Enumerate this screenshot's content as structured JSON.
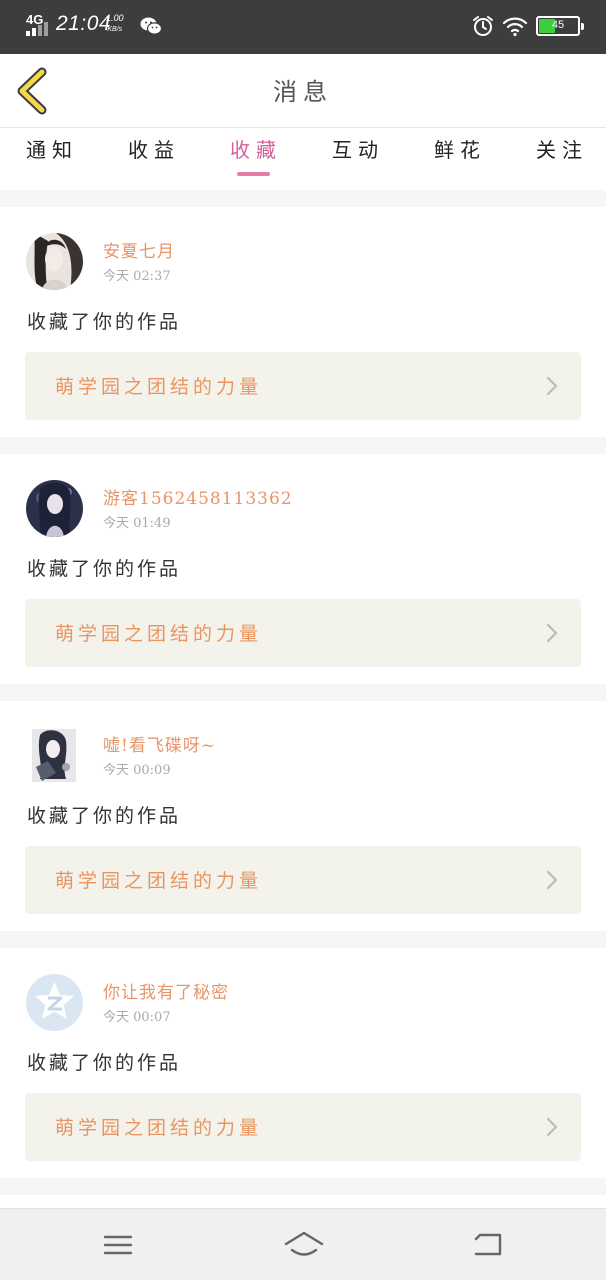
{
  "status_bar": {
    "network": "4G",
    "time": "21:04",
    "speed_value": "1.00",
    "speed_unit": "KB/s",
    "battery_text": "45",
    "battery_level": 0.45,
    "icons": [
      "signal-icon",
      "wechat-icon",
      "alarm-icon",
      "wifi-icon",
      "battery-icon"
    ]
  },
  "header": {
    "title": "消息",
    "back_icon": "chevron-left-icon"
  },
  "tabs": [
    {
      "label": "通知"
    },
    {
      "label": "收益"
    },
    {
      "label": "收藏",
      "active": true
    },
    {
      "label": "互动"
    },
    {
      "label": "鲜花"
    },
    {
      "label": "关注"
    }
  ],
  "colors": {
    "accent_pink": "#d6609a",
    "name_orange": "#e8956a",
    "work_orange": "#ea9560",
    "status_bar": "#3d3d3d",
    "battery_green": "#3ccf3c"
  },
  "notifications": [
    {
      "user": "安夏七月",
      "time": "今天 02:37",
      "action": "收藏了你的作品",
      "work": "萌学园之团结的力量"
    },
    {
      "user": "游客1562458113362",
      "time": "今天 01:49",
      "action": "收藏了你的作品",
      "work": "萌学园之团结的力量"
    },
    {
      "user": "嘘!看飞碟呀~",
      "time": "今天 00:09",
      "action": "收藏了你的作品",
      "work": "萌学园之团结的力量"
    },
    {
      "user": "你让我有了秘密",
      "time": "今天 00:07",
      "action": "收藏了你的作品",
      "work": "萌学园之团结的力量"
    }
  ],
  "nav_bar": {
    "icons": [
      "menu-icon",
      "home-icon",
      "back-icon"
    ]
  }
}
